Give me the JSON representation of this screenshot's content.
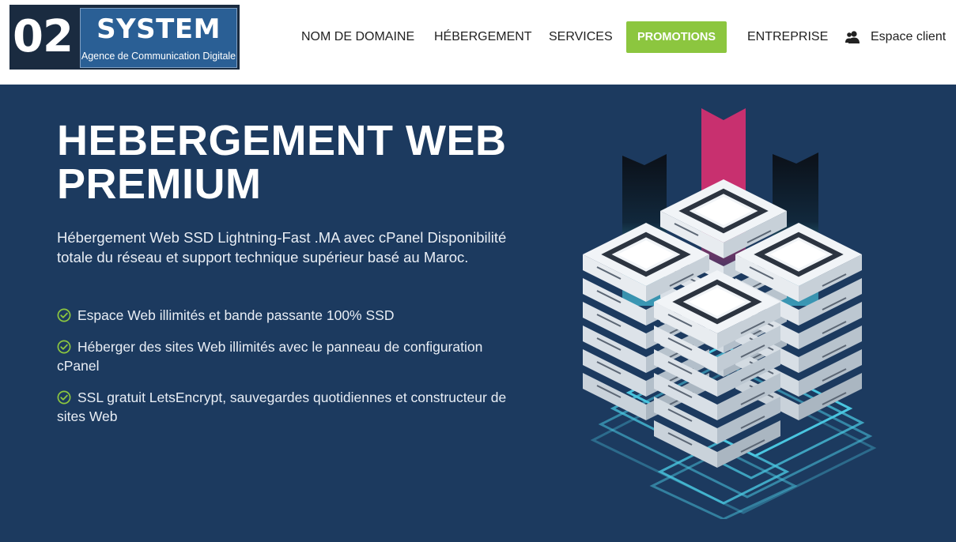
{
  "brand": {
    "number": "02",
    "word": "SYSTEM",
    "tagline": "Agence de Communication Digitale"
  },
  "nav": {
    "items": [
      "NOM DE DOMAINE",
      "HÉBERGEMENT",
      "SERVICES"
    ],
    "promo": "PROMOTIONS",
    "company": "ENTREPRISE",
    "client": "Espace client",
    "client_icon": "users-icon"
  },
  "hero": {
    "title_line1": "HEBERGEMENT WEB",
    "title_line2": "PREMIUM",
    "subtitle": "Hébergement Web SSD Lightning-Fast .MA avec cPanel Disponibilité totale du réseau et support technique supérieur basé au Maroc.",
    "features": [
      "Espace Web illimités et bande passante 100% SSD",
      "Héberger des sites Web illimités avec le panneau de configuration cPanel",
      "SSL gratuit LetsEncrypt, sauvegardes quotidiennes et constructeur de sites Web"
    ],
    "check_icon": "check-circle-icon",
    "illustration": "server-racks-illustration"
  },
  "colors": {
    "hero_bg": "#1c3a5f",
    "promo_bg": "#8cc63f",
    "check": "#8cc63f",
    "accent_pink": "#c2306f",
    "glow_cyan": "#4fd6ee"
  }
}
